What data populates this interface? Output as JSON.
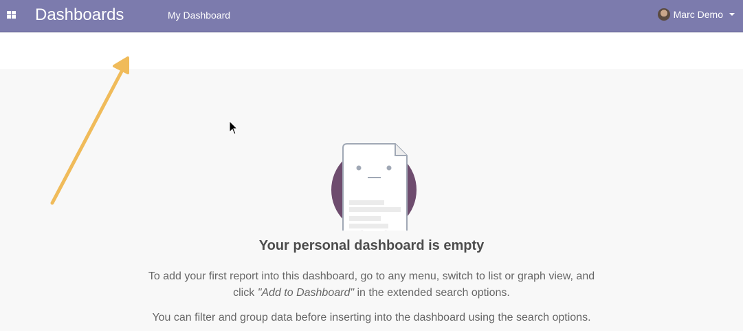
{
  "navbar": {
    "app_title": "Dashboards",
    "menu_item": "My Dashboard",
    "user_name": "Marc Demo"
  },
  "empty_state": {
    "title": "Your personal dashboard is empty",
    "line1": "To add your first report into this dashboard, go to any menu, switch to list or graph view, and",
    "line2_prefix": "click ",
    "line2_em": "\"Add to Dashboard\"",
    "line2_suffix": " in the extended search options.",
    "line3": "You can filter and group data before inserting into the dashboard using the search options."
  },
  "colors": {
    "navbar": "#7c7bad",
    "circle": "#6e4c6e",
    "arrow": "#f0bb5a"
  }
}
